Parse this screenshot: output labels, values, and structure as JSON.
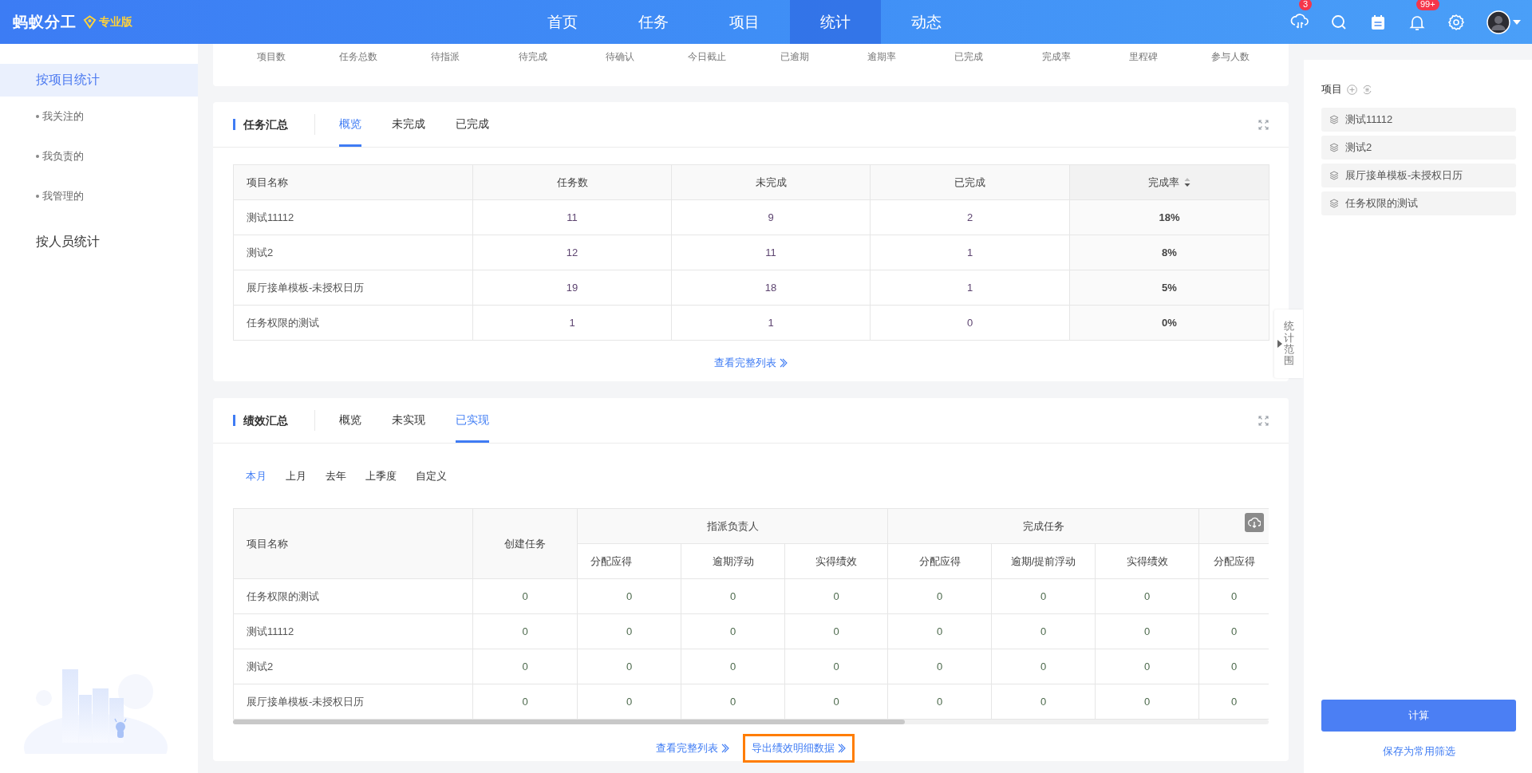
{
  "header": {
    "logo": "蚂蚁分工",
    "edition": "专业版",
    "nav": [
      {
        "label": "首页",
        "selected": false
      },
      {
        "label": "任务",
        "selected": false
      },
      {
        "label": "项目",
        "selected": false
      },
      {
        "label": "统计",
        "selected": true
      },
      {
        "label": "动态",
        "selected": false
      }
    ],
    "tools": [
      {
        "kind": "sync",
        "badge": "3"
      },
      {
        "kind": "search"
      },
      {
        "kind": "calendar"
      },
      {
        "kind": "bell",
        "badge": "99+"
      },
      {
        "kind": "settings"
      }
    ]
  },
  "sidebar": {
    "items": [
      {
        "label": "按项目统计",
        "selected": true,
        "children": [
          {
            "label": "我关注的",
            "selected": false
          },
          {
            "label": "我负责的",
            "selected": false
          },
          {
            "label": "我管理的",
            "selected": false
          }
        ]
      },
      {
        "label": "按人员统计",
        "selected": false
      }
    ]
  },
  "summary": {
    "labels": [
      "项目数",
      "任务总数",
      "待指派",
      "待完成",
      "待确认",
      "今日截止",
      "已逾期",
      "逾期率",
      "已完成",
      "完成率",
      "里程碑",
      "参与人数"
    ]
  },
  "task_summary": {
    "title": "任务汇总",
    "tabs": [
      {
        "label": "概览",
        "selected": true
      },
      {
        "label": "未完成",
        "selected": false
      },
      {
        "label": "已完成",
        "selected": false
      }
    ],
    "table": {
      "columns": [
        {
          "label": "项目名称",
          "sorted": false
        },
        {
          "label": "任务数",
          "sorted": false
        },
        {
          "label": "未完成",
          "sorted": false
        },
        {
          "label": "已完成",
          "sorted": false
        },
        {
          "label": "完成率",
          "sorted": true
        }
      ],
      "rows": [
        [
          "测试11112",
          "11",
          "9",
          "2",
          "18%"
        ],
        [
          "测试2",
          "12",
          "11",
          "1",
          "8%"
        ],
        [
          "展厅接单模板-未授权日历",
          "19",
          "18",
          "1",
          "5%"
        ],
        [
          "任务权限的测试",
          "1",
          "1",
          "0",
          "0%"
        ]
      ]
    },
    "more_link": "查看完整列表"
  },
  "performance_summary": {
    "title": "绩效汇总",
    "tabs": [
      {
        "label": "概览",
        "selected": false
      },
      {
        "label": "未实现",
        "selected": false
      },
      {
        "label": "已实现",
        "selected": true
      }
    ],
    "periods": [
      {
        "label": "本月",
        "selected": true
      },
      {
        "label": "上月",
        "selected": false
      },
      {
        "label": "去年",
        "selected": false
      },
      {
        "label": "上季度",
        "selected": false
      },
      {
        "label": "自定义",
        "selected": false
      }
    ],
    "table": {
      "columns": [
        {
          "label": "项目名称"
        },
        {
          "label": "创建任务"
        },
        {
          "label": "指派负责人",
          "colspan": 3,
          "children": [
            "分配应得",
            "逾期浮动",
            "实得绩效"
          ]
        },
        {
          "label": "完成任务",
          "colspan": 3,
          "children": [
            "分配应得",
            "逾期/提前浮动",
            "实得绩效"
          ]
        },
        {
          "children": [
            "分配应得"
          ]
        }
      ],
      "rows": [
        [
          "任务权限的测试",
          "0",
          "0",
          "0",
          "0",
          "0",
          "0",
          "0",
          "0"
        ],
        [
          "测试11112",
          "0",
          "0",
          "0",
          "0",
          "0",
          "0",
          "0",
          "0"
        ],
        [
          "测试2",
          "0",
          "0",
          "0",
          "0",
          "0",
          "0",
          "0",
          "0"
        ],
        [
          "展厅接单模板-未授权日历",
          "0",
          "0",
          "0",
          "0",
          "0",
          "0",
          "0",
          "0"
        ]
      ]
    },
    "links": [
      {
        "label": "查看完整列表",
        "highlighted": false
      },
      {
        "label": "导出绩效明细数据",
        "highlighted": true
      }
    ]
  },
  "scope_toggle": "统计范围",
  "scope_panel": {
    "title": "项目",
    "projects": [
      "测试11112",
      "测试2",
      "展厅接单模板-未授权日历",
      "任务权限的测试"
    ],
    "calculate_button": "计算",
    "save_link": "保存为常用筛选"
  }
}
